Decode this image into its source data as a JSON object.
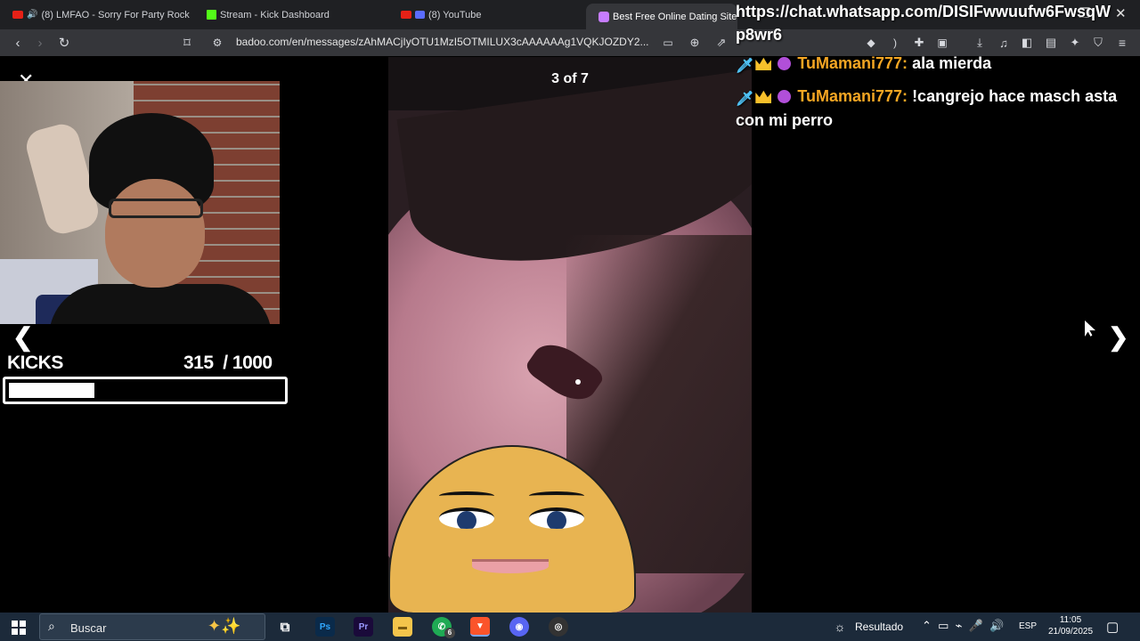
{
  "browser": {
    "tabs": [
      {
        "label": "(8) LMFAO - Sorry For Party Rock"
      },
      {
        "label": "Stream - Kick Dashboard"
      },
      {
        "label": "(8) YouTube"
      },
      {
        "label": "Best Free Online Dating Site"
      }
    ],
    "url": "badoo.com/en/messages/zAhMACjIyOTU1MzI5OTMILUX3cAAAAAAg1VQKJOZDY2..."
  },
  "chat": {
    "link_message": "https://chat.whatsapp.com/DISIFwwuufw6FwsqWp8wr6",
    "messages": [
      {
        "user": "TuMamani777:",
        "text": "ala mierda"
      },
      {
        "user": "TuMamani777:",
        "text": "!cangrejo hace masch asta con mi perro"
      }
    ]
  },
  "viewer": {
    "counter": "3 of 7",
    "close_icon": "close-icon",
    "prev_icon": "chevron-left-icon",
    "next_icon": "chevron-right-icon"
  },
  "kicks_goal": {
    "label": "KICKS",
    "current": "315",
    "target": "/ 1000",
    "progress_fraction": 0.315
  },
  "taskbar": {
    "search_placeholder": "Buscar",
    "whatsapp_badge": "6",
    "weather_label": "Resultado",
    "language": "ESP",
    "time": "11:05",
    "date": "21/09/2025"
  },
  "colors": {
    "chat_username": "#f5a623",
    "taskbar": "#1c2a3a",
    "browser_toolbar": "#35363a"
  }
}
